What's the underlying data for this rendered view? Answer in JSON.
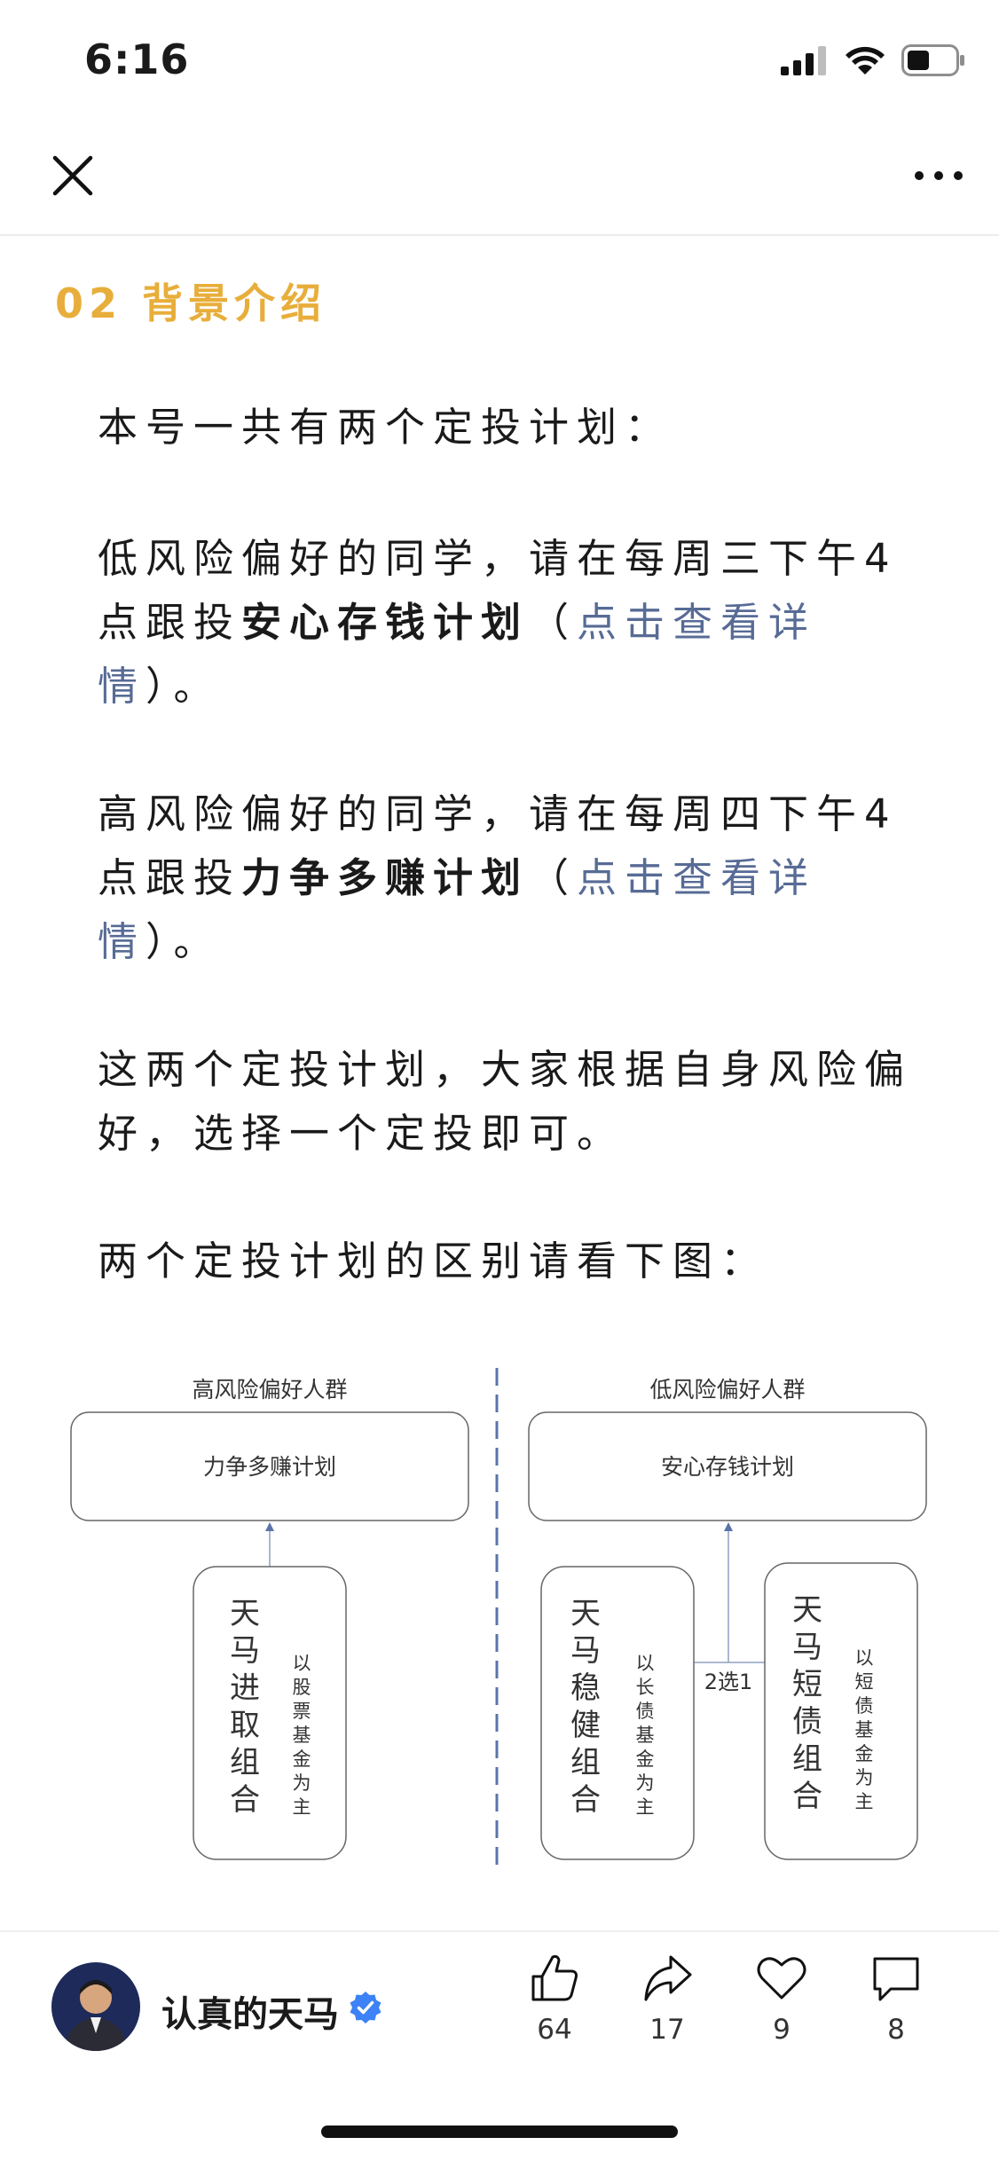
{
  "status_bar": {
    "time": "6:16"
  },
  "nav": {
    "close_icon": "close-icon",
    "more_icon": "more-icon"
  },
  "article": {
    "section_number": "02",
    "section_title": "背景介绍",
    "intro": "本号一共有两个定投计划：",
    "plan_low": {
      "text_before": "低风险偏好的同学，请在每周三下午4点跟投",
      "bold": "安心存钱计划",
      "paren_open": "（",
      "link": "点击查看详情",
      "paren_close": "）。"
    },
    "plan_high": {
      "text_before": "高风险偏好的同学，请在每周四下午4点跟投",
      "bold": "力争多赚计划",
      "paren_open": "（",
      "link": "点击查看详情",
      "paren_close": "）。"
    },
    "choose": "这两个定投计划，大家根据自身风险偏好，选择一个定投即可。",
    "diff_intro": "两个定投计划的区别请看下图："
  },
  "diagram": {
    "left_heading": "高风险偏好人群",
    "left_plan": "力争多赚计划",
    "left_portfolio": "天马进取组合",
    "left_note": "以股票基金为主",
    "right_heading": "低风险偏好人群",
    "right_plan": "安心存钱计划",
    "right_portfolio_a": "天马稳健组合",
    "right_note_a": "以长债基金为主",
    "choice_label": "2选1",
    "right_portfolio_b": "天马短债组合",
    "right_note_b": "以短债基金为主",
    "divider_color": "#5b73a8"
  },
  "bottom_bar": {
    "author": "认真的天马",
    "actions": [
      {
        "icon": "thumbs-up-icon",
        "count": "64"
      },
      {
        "icon": "share-icon",
        "count": "17"
      },
      {
        "icon": "heart-icon",
        "count": "9"
      },
      {
        "icon": "comment-icon",
        "count": "8"
      }
    ]
  },
  "colors": {
    "accent": "#e8ae3b",
    "link": "#576b95",
    "verified": "#3d82f6"
  }
}
